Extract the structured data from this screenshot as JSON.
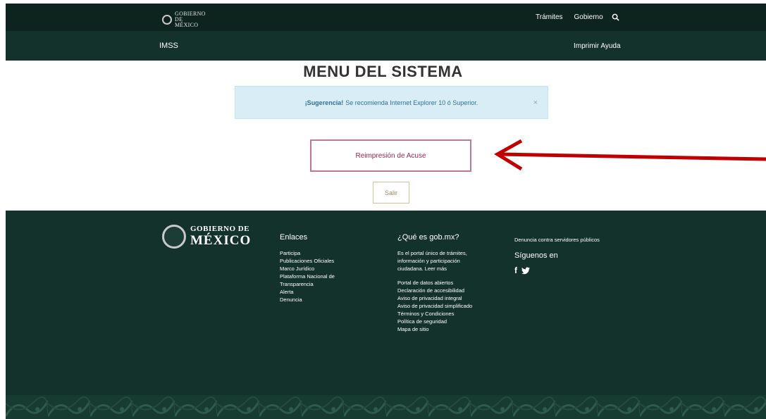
{
  "header": {
    "logo_text": "GOBIERNO DE MÉXICO",
    "nav": [
      "Trámites",
      "Gobierno"
    ],
    "search_icon": "search-icon"
  },
  "subheader": {
    "brand": "IMSS",
    "help": "Imprimir Ayuda"
  },
  "main": {
    "title": "MENU DEL SISTEMA",
    "alert": {
      "label": "¡Sugerencia!",
      "text": "Se recomienda Internet Explorer 10 ó Superior.",
      "close": "×"
    },
    "reprint_button": "Reimpresión de Acuse",
    "exit_button": "Salir"
  },
  "annotation": {
    "color": "#c00000"
  },
  "footer": {
    "logo_line1": "GOBIERNO DE",
    "logo_line2": "MÉXICO",
    "links_title": "Enlaces",
    "links": [
      "Participa",
      "Publicaciones Oficiales",
      "Marco Jurídico",
      "Plataforma Nacional de Transparencia",
      "Alerta",
      "Denuncia"
    ],
    "about_title": "¿Qué es gob.mx?",
    "about_text": "Es el portal único de trámites, información y participación ciudadana. Leer más",
    "about_links": [
      "Portal de datos abiertos",
      "Declaración de accesibilidad",
      "Aviso de privacidad integral",
      "Aviso de privacidad simplificado",
      "Términos y Condiciones",
      "Política de seguridad",
      "Mapa de sitio"
    ],
    "report": "Denuncia contra servidores públicos",
    "follow_title": "Síguenos en",
    "social": [
      "f",
      "twitter"
    ]
  },
  "colors": {
    "topbar": "#0c231e",
    "subbar": "#13322b",
    "footer": "#13322b",
    "accent": "#9d2449",
    "gold": "#b38e5d"
  }
}
